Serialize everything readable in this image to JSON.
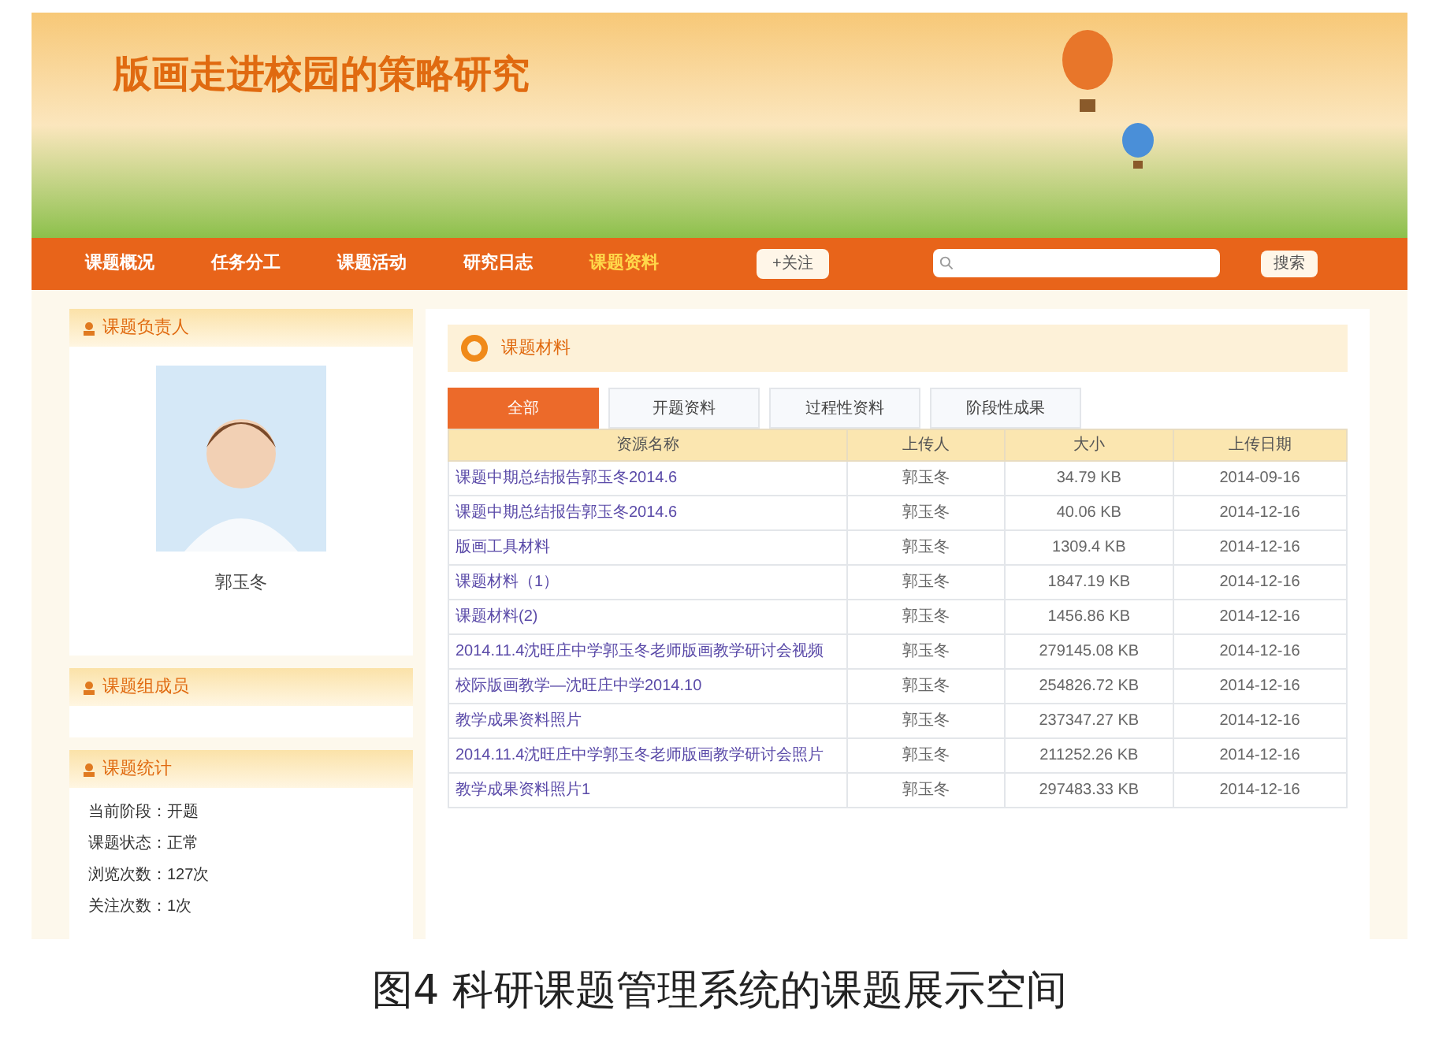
{
  "banner": {
    "title": "版画走进校园的策略研究"
  },
  "nav": {
    "items": [
      {
        "label": "课题概况",
        "selected": false
      },
      {
        "label": "任务分工",
        "selected": false
      },
      {
        "label": "课题活动",
        "selected": false
      },
      {
        "label": "研究日志",
        "selected": false
      },
      {
        "label": "课题资料",
        "selected": true
      }
    ],
    "follow_button": "+关注",
    "search_button": "搜索"
  },
  "sidebar": {
    "leader": {
      "title": "课题负责人",
      "name": "郭玉冬"
    },
    "members": {
      "title": "课题组成员"
    },
    "stats": {
      "title": "课题统计",
      "rows": [
        {
          "label": "当前阶段：",
          "value": "开题"
        },
        {
          "label": "课题状态：",
          "value": "正常"
        },
        {
          "label": "浏览次数：",
          "value": "127次"
        },
        {
          "label": "关注次数：",
          "value": "1次"
        }
      ]
    }
  },
  "materials": {
    "title": "课题材料",
    "tabs": [
      {
        "label": "全部",
        "selected": true
      },
      {
        "label": "开题资料",
        "selected": false
      },
      {
        "label": "过程性资料",
        "selected": false
      },
      {
        "label": "阶段性成果",
        "selected": false
      }
    ],
    "columns": [
      "资源名称",
      "上传人",
      "大小",
      "上传日期"
    ],
    "rows": [
      [
        "课题中期总结报告郭玉冬2014.6",
        "郭玉冬",
        "34.79 KB",
        "2014-09-16"
      ],
      [
        "课题中期总结报告郭玉冬2014.6",
        "郭玉冬",
        "40.06 KB",
        "2014-12-16"
      ],
      [
        "版画工具材料",
        "郭玉冬",
        "1309.4 KB",
        "2014-12-16"
      ],
      [
        "课题材料（1）",
        "郭玉冬",
        "1847.19 KB",
        "2014-12-16"
      ],
      [
        "课题材料(2)",
        "郭玉冬",
        "1456.86 KB",
        "2014-12-16"
      ],
      [
        "2014.11.4沈旺庄中学郭玉冬老师版画教学研讨会视频",
        "郭玉冬",
        "279145.08 KB",
        "2014-12-16"
      ],
      [
        "校际版画教学—沈旺庄中学2014.10",
        "郭玉冬",
        "254826.72 KB",
        "2014-12-16"
      ],
      [
        "教学成果资料照片",
        "郭玉冬",
        "237347.27 KB",
        "2014-12-16"
      ],
      [
        "2014.11.4沈旺庄中学郭玉冬老师版画教学研讨会照片",
        "郭玉冬",
        "211252.26 KB",
        "2014-12-16"
      ],
      [
        "教学成果资料照片1",
        "郭玉冬",
        "297483.33 KB",
        "2014-12-16"
      ]
    ]
  },
  "caption": "图4 科研课题管理系统的课题展示空间"
}
